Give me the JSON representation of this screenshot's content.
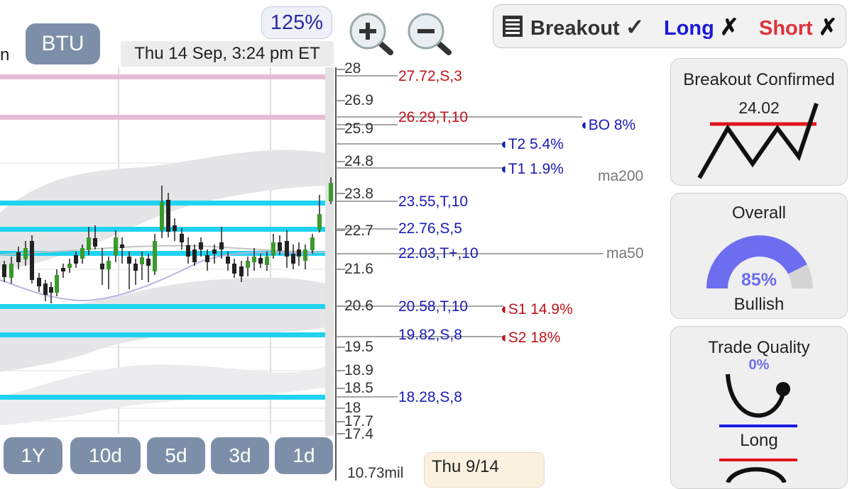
{
  "ticker": "BTU",
  "zoom_level": "125%",
  "timestamp": "Thu 14 Sep, 3:24 pm ET",
  "cut_label": "n",
  "toolbar": {
    "breakout": {
      "label": "Breakout",
      "mark": "✓"
    },
    "long": {
      "label": "Long",
      "mark": "✗"
    },
    "short": {
      "label": "Short",
      "mark": "✗"
    }
  },
  "axis_ticks": [
    "28",
    "26.9",
    "25.9",
    "24.8",
    "23.8",
    "22.7",
    "21.6",
    "20.6",
    "19.5",
    "18.9",
    "18.5",
    "18",
    "17.7",
    "17.4"
  ],
  "volume_label": "10.73mil",
  "levels": [
    {
      "text": "27.72,S,3",
      "color": "#c0121a"
    },
    {
      "text": "26.29,T,10",
      "color": "#c0121a"
    },
    {
      "text": "23.55,T,10",
      "color": "#1a1ab8"
    },
    {
      "text": "22.76,S,5",
      "color": "#1a1ab8"
    },
    {
      "text": "22.03,T+,10",
      "color": "#1a1ab8"
    },
    {
      "text": "20.58,T,10",
      "color": "#1a1ab8"
    },
    {
      "text": "19.82,S,8",
      "color": "#1a1ab8"
    },
    {
      "text": "18.28,S,8",
      "color": "#1a1ab8"
    }
  ],
  "targets": [
    {
      "text": "BO 8%",
      "color": "#1a1ab8"
    },
    {
      "text": "T2 5.4%",
      "color": "#1a1ab8"
    },
    {
      "text": "T1 1.9%",
      "color": "#1a1ab8"
    },
    {
      "text": "S1 14.9%",
      "color": "#c0121a"
    },
    {
      "text": "S2 18%",
      "color": "#c0121a"
    }
  ],
  "ma_labels": {
    "ma200": "ma200",
    "ma50": "ma50"
  },
  "range_buttons": [
    "1Y",
    "10d",
    "5d",
    "3d",
    "1d"
  ],
  "date_box": "Thu 9/14",
  "panels": {
    "breakout": {
      "title": "Breakout Confirmed",
      "value": "24.02"
    },
    "overall": {
      "title": "Overall",
      "percent": "85%",
      "percent_value": 85,
      "sentiment": "Bullish"
    },
    "trade_quality": {
      "title": "Trade Quality",
      "percent": "0%",
      "direction": "Long"
    }
  },
  "colors": {
    "support_band": "#1fd3f0",
    "resistance_band": "#e7bcd8",
    "gauge_fill": "#6d6df0",
    "bull_candle": "#3a9a2a",
    "bear_candle": "#222222",
    "button_bg": "#7d8fa8"
  },
  "icons": {
    "zoom_in": "zoom-in-icon",
    "zoom_out": "zoom-out-icon",
    "menu": "menu-icon"
  }
}
